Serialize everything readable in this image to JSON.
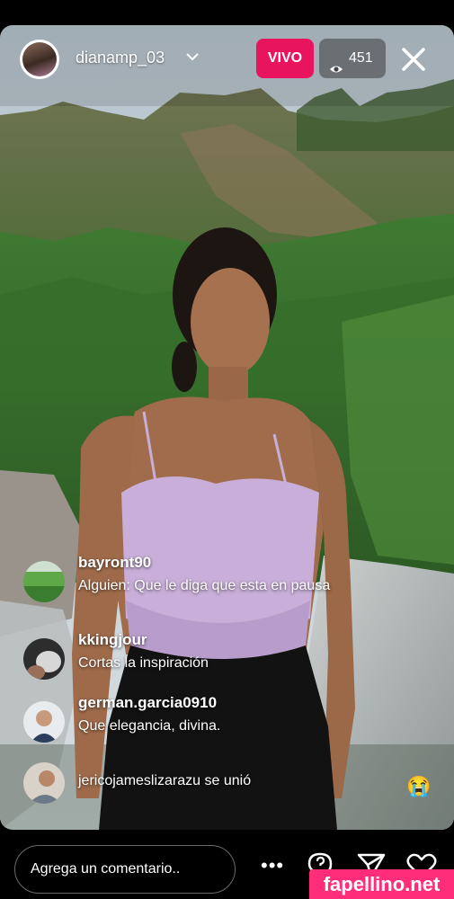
{
  "header": {
    "username": "dianamp_03",
    "live_label": "VIVO",
    "viewer_count": "451",
    "icons": {
      "dropdown": "chevron-down-icon",
      "viewers": "eye-icon",
      "close": "close-icon"
    }
  },
  "comments": [
    {
      "user": "bayront90",
      "text": "Alguien: Que le diga que esta en pausa"
    },
    {
      "user": "kkingjour",
      "text": "Cortas la inspiración"
    },
    {
      "user": "german.garcia0910",
      "text": "Que elegancia, divina."
    }
  ],
  "join_notice": {
    "text": "jericojameslizarazu se unió",
    "emoji": "😭"
  },
  "footer": {
    "comment_placeholder": "Agrega un comentario..",
    "more_label": "•••",
    "icons": {
      "question": "question-icon",
      "send": "send-icon",
      "like": "heart-icon"
    }
  },
  "watermark": "fapellino.net",
  "colors": {
    "live_badge": "#e8155e",
    "watermark": "#ff2d7a"
  }
}
